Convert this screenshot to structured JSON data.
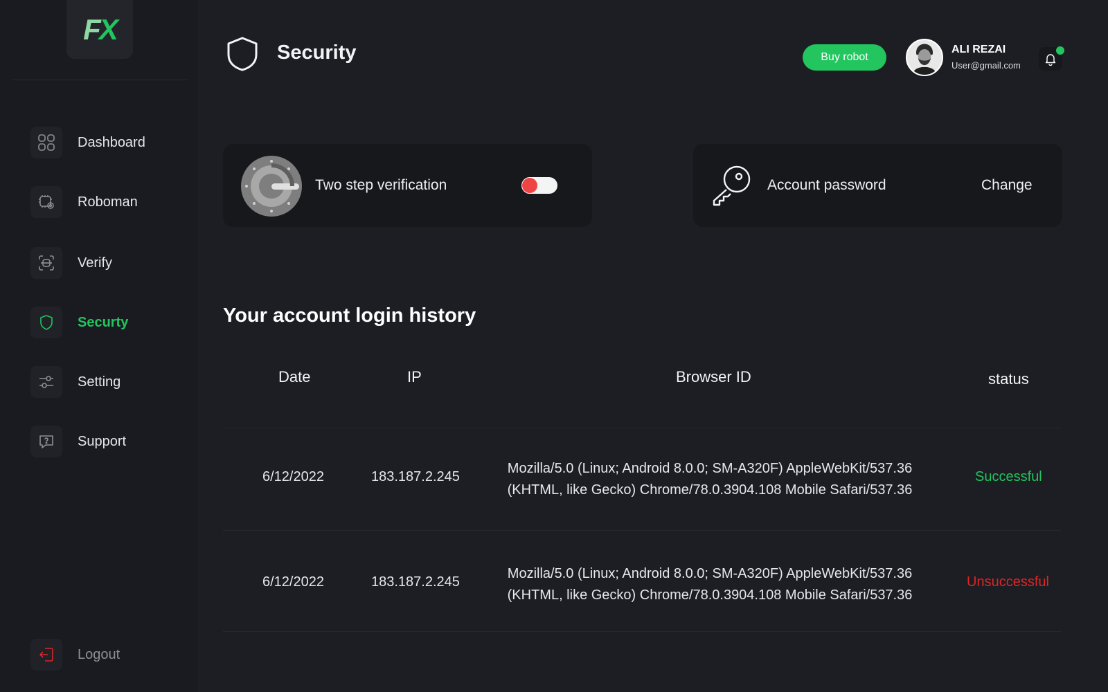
{
  "app": {
    "logo_text": "FX"
  },
  "sidebar": {
    "items": [
      {
        "label": "Dashboard",
        "icon": "grid-icon"
      },
      {
        "label": "Roboman",
        "icon": "robot-gear-icon"
      },
      {
        "label": "Verify",
        "icon": "scan-icon"
      },
      {
        "label": "Securty",
        "icon": "shield-icon",
        "active": true
      },
      {
        "label": "Setting",
        "icon": "sliders-icon"
      },
      {
        "label": "Support",
        "icon": "chat-help-icon"
      }
    ],
    "logout_label": "Logout"
  },
  "header": {
    "title": "Security",
    "buy_label": "Buy robot",
    "user_name": "ALI REZAI",
    "user_email": "User@gmail.com",
    "notification_indicator": true
  },
  "cards": {
    "two_step_label": "Two step verification",
    "two_step_enabled": false,
    "password_label": "Account password",
    "change_label": "Change"
  },
  "history": {
    "title": "Your account login history",
    "columns": {
      "date": "Date",
      "ip": "IP",
      "browser": "Browser ID",
      "status": "status"
    },
    "rows": [
      {
        "date": "6/12/2022",
        "ip": "183.187.2.245",
        "browser_line1": "Mozilla/5.0 (Linux; Android 8.0.0; SM-A320F) AppleWebKit/537.36",
        "browser_line2": "(KHTML, like Gecko) Chrome/78.0.3904.108 Mobile Safari/537.36",
        "status": "Successful"
      },
      {
        "date": "6/12/2022",
        "ip": "183.187.2.245",
        "browser_line1": "Mozilla/5.0 (Linux; Android 8.0.0; SM-A320F) AppleWebKit/537.36",
        "browser_line2": "(KHTML, like Gecko) Chrome/78.0.3904.108 Mobile Safari/537.36",
        "status": "Unsuccessful"
      }
    ]
  },
  "colors": {
    "accent": "#22c55e",
    "danger": "#dc2626",
    "background": "#1c1e23",
    "sidebar": "#191b20",
    "card": "#17181c"
  }
}
